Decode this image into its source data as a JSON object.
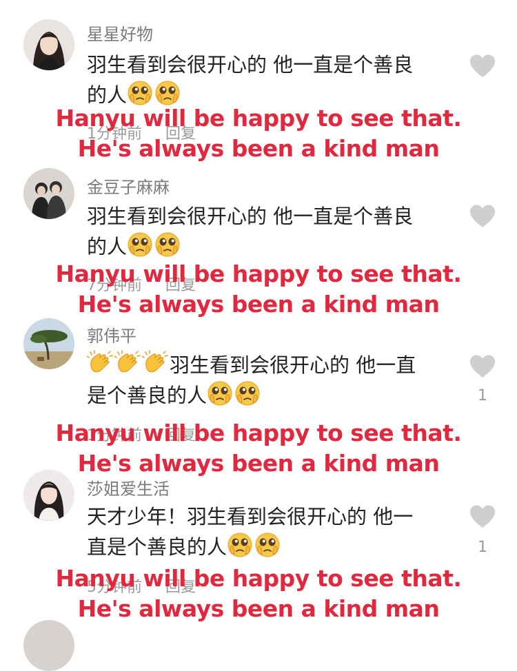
{
  "comments": [
    {
      "username": "星星好物",
      "text_line1": "羽生看到会很开心的 他一直是个善良",
      "text_line2": "的人",
      "time": "1分钟前",
      "reply": "回复",
      "likes": "",
      "caption_line1": "Hanyu will be happy to see that.",
      "caption_line2": "He's always been a kind man"
    },
    {
      "username": "金豆子麻麻",
      "text_line1": "羽生看到会很开心的 他一直是个善良",
      "text_line2": "的人",
      "time": "7分钟前",
      "reply": "回复",
      "likes": "",
      "caption_line1": "Hanyu will be happy to see that.",
      "caption_line2": "He's always been a kind man"
    },
    {
      "username": "郭伟平",
      "text_line1": "羽生看到会很开心的 他一直",
      "text_line2": "是个善良的人",
      "time": "1分钟前",
      "reply": "回复",
      "likes": "1",
      "caption_line1": "Hanyu will be happy to see that.",
      "caption_line2": "He's always been a kind man"
    },
    {
      "username": "莎姐爱生活",
      "text_line1": "天才少年！羽生看到会很开心的 他一",
      "text_line2": "直是个善良的人",
      "time": "5分钟前",
      "reply": "回复",
      "likes": "1",
      "caption_line1": "Hanyu will be happy to see that.",
      "caption_line2": "He's always been a kind man"
    }
  ],
  "icons": {
    "like": "heart-icon",
    "pleading": "pleading-face-emoji",
    "clap": "clapping-hands-emoji"
  },
  "colors": {
    "caption": "#e0283f",
    "username": "#7a7a7a",
    "heart": "#cfcfcf"
  }
}
